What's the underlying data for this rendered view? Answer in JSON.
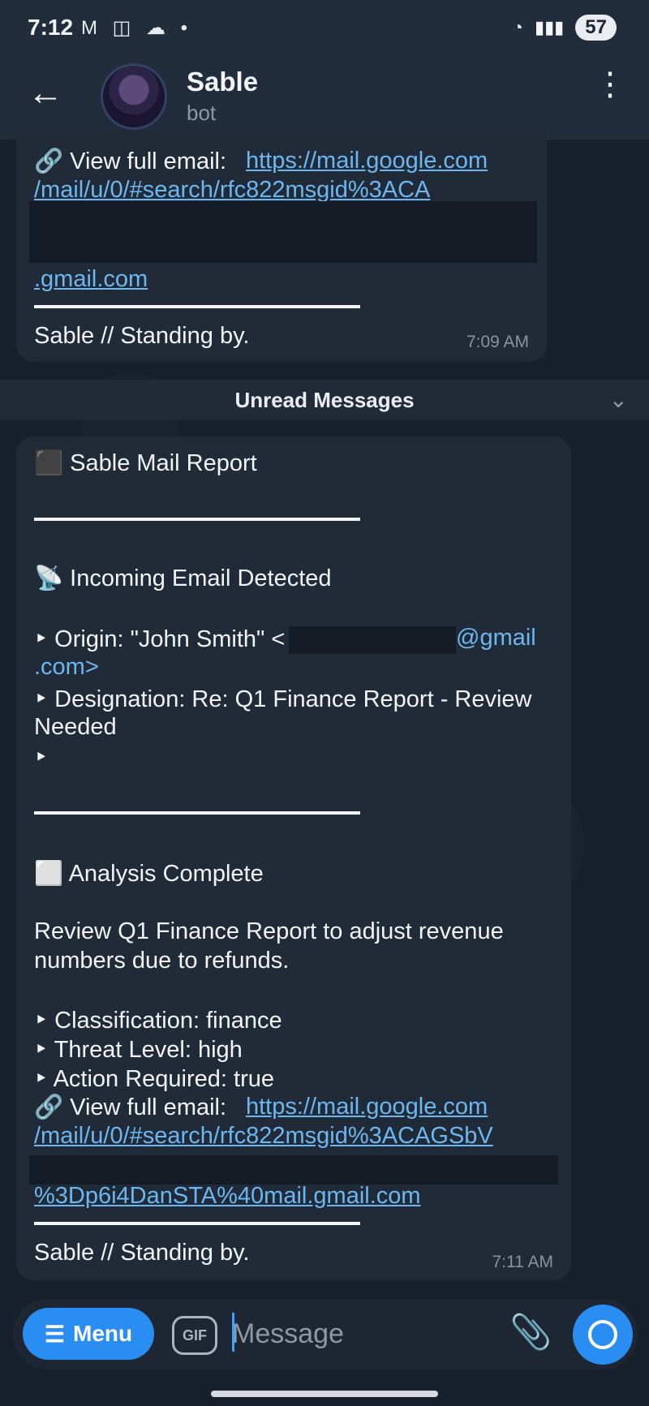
{
  "status_bar": {
    "time": "7:12",
    "icons": "M ◫ ☁ •",
    "battery": "57",
    "signal": "▮▮▮"
  },
  "header": {
    "back_icon": "←",
    "title": "Sable",
    "subtitle": "bot",
    "more_icon": "⋮"
  },
  "messages": [
    {
      "view_label": "🔗 View full email: ",
      "link_line1": "https://mail.google.com",
      "link_line2": "/mail/u/0/#search/rfc822msgid%3ACA",
      "link_line3": ".gmail.com",
      "footer": "Sable // Standing by.",
      "time": "7:09 AM"
    },
    {
      "title": "⬛ Sable Mail Report",
      "incoming": "📡 Incoming Email Detected",
      "origin_prefix": "‣ Origin: \"John Smith\" <",
      "origin_suffix": "@gmail",
      "origin_line2": ".com>",
      "designation_line1": "‣ Designation: Re: Q1 Finance Report - Review",
      "designation_line2": "Needed",
      "bullet": "‣",
      "analysis": "⬜ Analysis Complete",
      "summary_line1": "Review Q1 Finance Report to adjust revenue",
      "summary_line2": "numbers due to refunds.",
      "classification": "‣ Classification: finance",
      "threat": "‣ Threat Level: high",
      "action": "‣ Action Required: true",
      "view_label": "🔗 View full email: ",
      "link_line1": "https://mail.google.com",
      "link_line2": "/mail/u/0/#search/rfc822msgid%3ACAGSbV",
      "link_line3": "%3Dp6i4DanSTA%40mail.gmail.com",
      "footer": "Sable // Standing by.",
      "time": "7:11 AM"
    }
  ],
  "unread_label": "Unread Messages",
  "input_bar": {
    "menu_label": "Menu",
    "gif_label": "GIF",
    "placeholder": "Message"
  }
}
